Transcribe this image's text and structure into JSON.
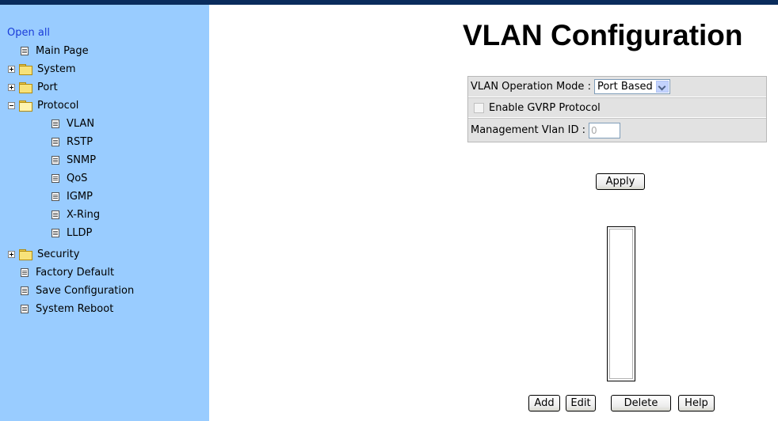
{
  "sidebar": {
    "open_all": "Open all",
    "items": [
      {
        "label": "Main Page",
        "type": "page"
      },
      {
        "label": "System",
        "type": "folder",
        "state": "closed"
      },
      {
        "label": "Port",
        "type": "folder",
        "state": "closed"
      },
      {
        "label": "Protocol",
        "type": "folder",
        "state": "open"
      },
      {
        "label": "VLAN",
        "type": "page"
      },
      {
        "label": "RSTP",
        "type": "page"
      },
      {
        "label": "SNMP",
        "type": "page"
      },
      {
        "label": "QoS",
        "type": "page"
      },
      {
        "label": "IGMP",
        "type": "page"
      },
      {
        "label": "X-Ring",
        "type": "page"
      },
      {
        "label": "LLDP",
        "type": "page"
      },
      {
        "label": "Security",
        "type": "folder",
        "state": "closed"
      },
      {
        "label": "Factory Default",
        "type": "page"
      },
      {
        "label": "Save Configuration",
        "type": "page"
      },
      {
        "label": "System Reboot",
        "type": "page"
      }
    ]
  },
  "main": {
    "title": "VLAN Configuration",
    "vlan_mode": {
      "label": "VLAN Operation Mode :",
      "value": "Port Based"
    },
    "gvrp": {
      "label": "Enable GVRP Protocol",
      "checked": false
    },
    "mgmt_vlan": {
      "label": "Management Vlan ID :",
      "value": "0"
    },
    "buttons": {
      "apply": "Apply",
      "add": "Add",
      "edit": "Edit",
      "delete": "Delete",
      "help": "Help"
    }
  },
  "colors": {
    "sidebar_bg": "#99ccff",
    "top_bar": "#0a2c5c",
    "link": "#1a3cd8",
    "table_bg": "#e2e2e2"
  }
}
